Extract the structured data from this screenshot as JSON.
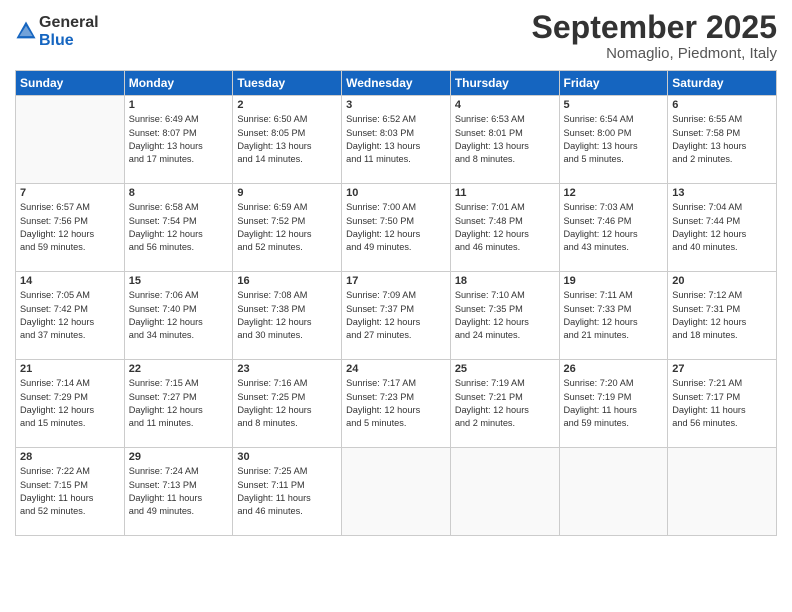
{
  "logo": {
    "general": "General",
    "blue": "Blue"
  },
  "title": "September 2025",
  "location": "Nomaglio, Piedmont, Italy",
  "headers": [
    "Sunday",
    "Monday",
    "Tuesday",
    "Wednesday",
    "Thursday",
    "Friday",
    "Saturday"
  ],
  "weeks": [
    [
      {
        "num": "",
        "info": ""
      },
      {
        "num": "1",
        "info": "Sunrise: 6:49 AM\nSunset: 8:07 PM\nDaylight: 13 hours\nand 17 minutes."
      },
      {
        "num": "2",
        "info": "Sunrise: 6:50 AM\nSunset: 8:05 PM\nDaylight: 13 hours\nand 14 minutes."
      },
      {
        "num": "3",
        "info": "Sunrise: 6:52 AM\nSunset: 8:03 PM\nDaylight: 13 hours\nand 11 minutes."
      },
      {
        "num": "4",
        "info": "Sunrise: 6:53 AM\nSunset: 8:01 PM\nDaylight: 13 hours\nand 8 minutes."
      },
      {
        "num": "5",
        "info": "Sunrise: 6:54 AM\nSunset: 8:00 PM\nDaylight: 13 hours\nand 5 minutes."
      },
      {
        "num": "6",
        "info": "Sunrise: 6:55 AM\nSunset: 7:58 PM\nDaylight: 13 hours\nand 2 minutes."
      }
    ],
    [
      {
        "num": "7",
        "info": "Sunrise: 6:57 AM\nSunset: 7:56 PM\nDaylight: 12 hours\nand 59 minutes."
      },
      {
        "num": "8",
        "info": "Sunrise: 6:58 AM\nSunset: 7:54 PM\nDaylight: 12 hours\nand 56 minutes."
      },
      {
        "num": "9",
        "info": "Sunrise: 6:59 AM\nSunset: 7:52 PM\nDaylight: 12 hours\nand 52 minutes."
      },
      {
        "num": "10",
        "info": "Sunrise: 7:00 AM\nSunset: 7:50 PM\nDaylight: 12 hours\nand 49 minutes."
      },
      {
        "num": "11",
        "info": "Sunrise: 7:01 AM\nSunset: 7:48 PM\nDaylight: 12 hours\nand 46 minutes."
      },
      {
        "num": "12",
        "info": "Sunrise: 7:03 AM\nSunset: 7:46 PM\nDaylight: 12 hours\nand 43 minutes."
      },
      {
        "num": "13",
        "info": "Sunrise: 7:04 AM\nSunset: 7:44 PM\nDaylight: 12 hours\nand 40 minutes."
      }
    ],
    [
      {
        "num": "14",
        "info": "Sunrise: 7:05 AM\nSunset: 7:42 PM\nDaylight: 12 hours\nand 37 minutes."
      },
      {
        "num": "15",
        "info": "Sunrise: 7:06 AM\nSunset: 7:40 PM\nDaylight: 12 hours\nand 34 minutes."
      },
      {
        "num": "16",
        "info": "Sunrise: 7:08 AM\nSunset: 7:38 PM\nDaylight: 12 hours\nand 30 minutes."
      },
      {
        "num": "17",
        "info": "Sunrise: 7:09 AM\nSunset: 7:37 PM\nDaylight: 12 hours\nand 27 minutes."
      },
      {
        "num": "18",
        "info": "Sunrise: 7:10 AM\nSunset: 7:35 PM\nDaylight: 12 hours\nand 24 minutes."
      },
      {
        "num": "19",
        "info": "Sunrise: 7:11 AM\nSunset: 7:33 PM\nDaylight: 12 hours\nand 21 minutes."
      },
      {
        "num": "20",
        "info": "Sunrise: 7:12 AM\nSunset: 7:31 PM\nDaylight: 12 hours\nand 18 minutes."
      }
    ],
    [
      {
        "num": "21",
        "info": "Sunrise: 7:14 AM\nSunset: 7:29 PM\nDaylight: 12 hours\nand 15 minutes."
      },
      {
        "num": "22",
        "info": "Sunrise: 7:15 AM\nSunset: 7:27 PM\nDaylight: 12 hours\nand 11 minutes."
      },
      {
        "num": "23",
        "info": "Sunrise: 7:16 AM\nSunset: 7:25 PM\nDaylight: 12 hours\nand 8 minutes."
      },
      {
        "num": "24",
        "info": "Sunrise: 7:17 AM\nSunset: 7:23 PM\nDaylight: 12 hours\nand 5 minutes."
      },
      {
        "num": "25",
        "info": "Sunrise: 7:19 AM\nSunset: 7:21 PM\nDaylight: 12 hours\nand 2 minutes."
      },
      {
        "num": "26",
        "info": "Sunrise: 7:20 AM\nSunset: 7:19 PM\nDaylight: 11 hours\nand 59 minutes."
      },
      {
        "num": "27",
        "info": "Sunrise: 7:21 AM\nSunset: 7:17 PM\nDaylight: 11 hours\nand 56 minutes."
      }
    ],
    [
      {
        "num": "28",
        "info": "Sunrise: 7:22 AM\nSunset: 7:15 PM\nDaylight: 11 hours\nand 52 minutes."
      },
      {
        "num": "29",
        "info": "Sunrise: 7:24 AM\nSunset: 7:13 PM\nDaylight: 11 hours\nand 49 minutes."
      },
      {
        "num": "30",
        "info": "Sunrise: 7:25 AM\nSunset: 7:11 PM\nDaylight: 11 hours\nand 46 minutes."
      },
      {
        "num": "",
        "info": ""
      },
      {
        "num": "",
        "info": ""
      },
      {
        "num": "",
        "info": ""
      },
      {
        "num": "",
        "info": ""
      }
    ]
  ]
}
